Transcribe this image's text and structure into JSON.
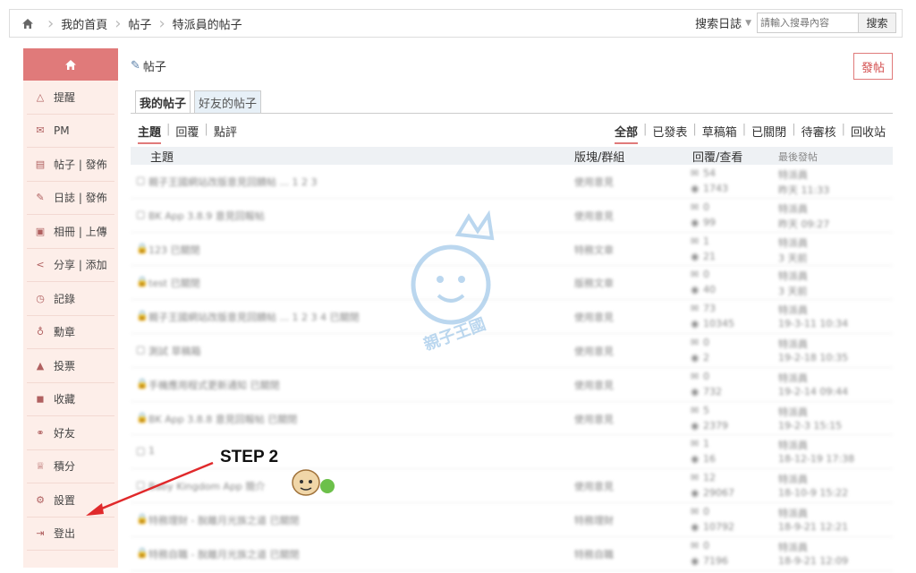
{
  "breadcrumb": [
    "我的首頁",
    "帖子",
    "特派員的帖子"
  ],
  "search": {
    "label": "搜索日誌",
    "placeholder": "請輸入搜尋內容",
    "button": "搜索"
  },
  "sidebar": {
    "items": [
      {
        "icon": "bell-icon",
        "glyph": "△",
        "label": "提醒"
      },
      {
        "icon": "mail-icon",
        "glyph": "✉",
        "label": "PM"
      },
      {
        "icon": "doc-icon",
        "glyph": "▤",
        "label": "帖子 | 發佈"
      },
      {
        "icon": "pen-icon",
        "glyph": "✎",
        "label": "日誌 | 發佈"
      },
      {
        "icon": "photo-icon",
        "glyph": "▣",
        "label": "相冊 | 上傳"
      },
      {
        "icon": "share-icon",
        "glyph": "<",
        "label": "分享 | 添加"
      },
      {
        "icon": "history-icon",
        "glyph": "◷",
        "label": "記錄"
      },
      {
        "icon": "medal-icon",
        "glyph": "♁",
        "label": "勳章"
      },
      {
        "icon": "vote-icon",
        "glyph": "▲",
        "label": "投票"
      },
      {
        "icon": "bookmark-icon",
        "glyph": "◼",
        "label": "收藏"
      },
      {
        "icon": "handshake-icon",
        "glyph": "⚭",
        "label": "好友"
      },
      {
        "icon": "trophy-icon",
        "glyph": "♕",
        "label": "積分"
      },
      {
        "icon": "gear-icon",
        "glyph": "⚙",
        "label": "設置"
      },
      {
        "icon": "logout-icon",
        "glyph": "⇥",
        "label": "登出"
      }
    ]
  },
  "main": {
    "title": "帖子",
    "post_button": "發帖",
    "tabs": [
      "我的帖子",
      "好友的帖子"
    ],
    "filters_left": [
      "主題",
      "回覆",
      "點評"
    ],
    "filters_right": [
      "全部",
      "已發表",
      "草稿箱",
      "已關閉",
      "待審核",
      "回收站"
    ],
    "columns": {
      "topic": "主題",
      "board": "版塊/群組",
      "reply": "回覆/查看",
      "last": "最後發帖"
    }
  },
  "rows": [
    {
      "title": "親子王國網站改版意見回饋帖 ... 1 2 3",
      "board": "使用意見",
      "reply": "54",
      "view": "1743",
      "last_user": "特派員",
      "last_time": "昨天 11:33",
      "lock": false
    },
    {
      "title": "BK App 3.8.9 意見回報帖",
      "board": "使用意見",
      "reply": "0",
      "view": "99",
      "last_user": "特派員",
      "last_time": "昨天 09:27",
      "lock": false
    },
    {
      "title": "123 已關閉",
      "board": "特務文章",
      "reply": "1",
      "view": "21",
      "last_user": "特派員",
      "last_time": "3 天前",
      "lock": true
    },
    {
      "title": "test 已關閉",
      "board": "版務文章",
      "reply": "0",
      "view": "40",
      "last_user": "特派員",
      "last_time": "3 天前",
      "lock": true
    },
    {
      "title": "親子王國網站改版意見回饋帖 ... 1 2 3 4 已關閉",
      "board": "使用意見",
      "reply": "73",
      "view": "10345",
      "last_user": "特派員",
      "last_time": "19-3-11 10:34",
      "lock": true
    },
    {
      "title": "測試 草稿箱",
      "board": "使用意見",
      "reply": "0",
      "view": "2",
      "last_user": "特派員",
      "last_time": "19-2-18 10:35",
      "lock": false
    },
    {
      "title": "手機應用程式更新通知 已關閉",
      "board": "使用意見",
      "reply": "0",
      "view": "732",
      "last_user": "特派員",
      "last_time": "19-2-14 09:44",
      "lock": true
    },
    {
      "title": "BK App 3.8.8 意見回報帖 已關閉",
      "board": "使用意見",
      "reply": "5",
      "view": "2379",
      "last_user": "特派員",
      "last_time": "19-2-3 15:15",
      "lock": true
    },
    {
      "title": "1",
      "board": "",
      "reply": "1",
      "view": "16",
      "last_user": "特派員",
      "last_time": "18-12-19 17:38",
      "lock": false
    },
    {
      "title": "Baby Kingdom App 簡介",
      "board": "使用意見",
      "reply": "12",
      "view": "29067",
      "last_user": "特派員",
      "last_time": "18-10-9 15:22",
      "lock": false
    },
    {
      "title": "特務理財 - 脫離月光族之道 已關閉",
      "board": "特務理財",
      "reply": "0",
      "view": "10792",
      "last_user": "特派員",
      "last_time": "18-9-21 12:21",
      "lock": true
    },
    {
      "title": "特務自職 - 脫離月光族之道 已關閉",
      "board": "特務自職",
      "reply": "0",
      "view": "7196",
      "last_user": "特派員",
      "last_time": "18-9-21 12:09",
      "lock": true
    }
  ],
  "watermark_text": "親子王國 Baby Kingdom",
  "annotation": {
    "label": "STEP 2",
    "color": "#e0292b"
  }
}
